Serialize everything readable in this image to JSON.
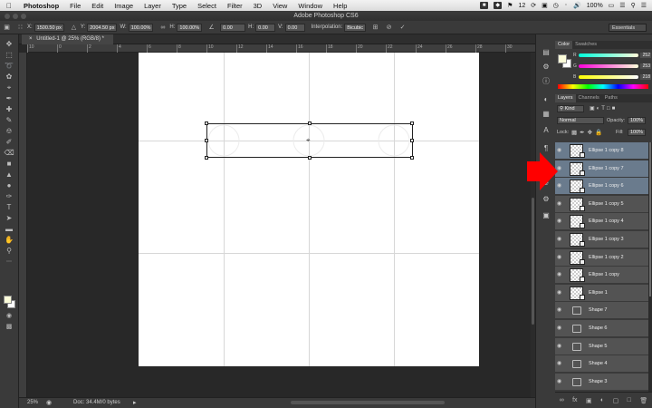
{
  "menubar": {
    "app": "Photoshop",
    "items": [
      "File",
      "Edit",
      "Image",
      "Layer",
      "Type",
      "Select",
      "Filter",
      "3D",
      "View",
      "Window",
      "Help"
    ],
    "status": {
      "badge": "12",
      "battery": "100%",
      "clock": "□"
    }
  },
  "window": {
    "title": "Adobe Photoshop CS6"
  },
  "options": {
    "x_label": "X:",
    "x_value": "1500.50 px",
    "y_label": "Y:",
    "y_value": "2004.50 px",
    "w_label": "W:",
    "w_value": "100.00%",
    "h_label": "H:",
    "h_value": "100.00%",
    "angle_value": "0.00",
    "hskew_label": "H:",
    "hskew_value": "0.00",
    "vskew_label": "V:",
    "vskew_value": "0.00",
    "interp_label": "Interpolation:",
    "interp_value": "Bicubic",
    "workspace": "Essentials"
  },
  "document": {
    "tab": "Untitled-1 @ 25% (RGB/8) *",
    "zoom": "25%",
    "doc_size": "Doc: 34.4M/0 bytes",
    "ruler_ticks": [
      "10",
      "0",
      "2",
      "4",
      "6",
      "8",
      "10",
      "12",
      "14",
      "16",
      "18",
      "20",
      "22",
      "24",
      "26",
      "28",
      "30"
    ]
  },
  "color_panel": {
    "tabs": [
      "Color",
      "Swatches"
    ],
    "r_label": "R",
    "r_value": "252",
    "g_label": "G",
    "g_value": "253",
    "b_label": "B",
    "b_value": "218",
    "foreground": "#fcfdda"
  },
  "layers_panel": {
    "tabs": [
      "Layers",
      "Channels",
      "Paths"
    ],
    "filter": "Kind",
    "blend_mode": "Normal",
    "opacity_label": "Opacity:",
    "opacity_value": "100%",
    "lock_label": "Lock:",
    "fill_label": "Fill:",
    "fill_value": "100%",
    "layers": [
      {
        "name": "Ellipse 1 copy 8",
        "kind": "ellipse",
        "selected": true
      },
      {
        "name": "Ellipse 1 copy 7",
        "kind": "ellipse",
        "selected": true
      },
      {
        "name": "Ellipse 1 copy 6",
        "kind": "ellipse",
        "selected": true
      },
      {
        "name": "Ellipse 1 copy 5",
        "kind": "ellipse",
        "selected": false
      },
      {
        "name": "Ellipse 1 copy 4",
        "kind": "ellipse",
        "selected": false
      },
      {
        "name": "Ellipse 1 copy 3",
        "kind": "ellipse",
        "selected": false
      },
      {
        "name": "Ellipse 1 copy 2",
        "kind": "ellipse",
        "selected": false
      },
      {
        "name": "Ellipse 1 copy",
        "kind": "ellipse",
        "selected": false
      },
      {
        "name": "Ellipse 1",
        "kind": "ellipse",
        "selected": false
      },
      {
        "name": "Shape 7",
        "kind": "shape",
        "selected": false
      },
      {
        "name": "Shape 6",
        "kind": "shape",
        "selected": false
      },
      {
        "name": "Shape 5",
        "kind": "shape",
        "selected": false
      },
      {
        "name": "Shape 4",
        "kind": "shape",
        "selected": false
      },
      {
        "name": "Shape 3",
        "kind": "shape",
        "selected": false
      }
    ]
  },
  "colors": {
    "selected_layer": "#6a7b8d",
    "annotation_arrow": "#ff0000"
  }
}
